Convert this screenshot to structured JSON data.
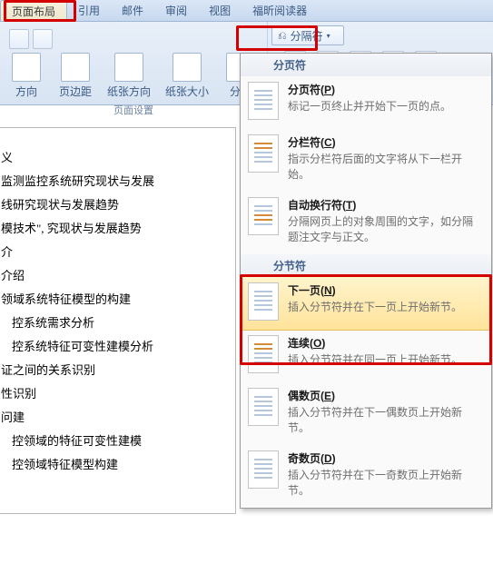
{
  "tabs": {
    "page_layout": "页面布局",
    "references": "引用",
    "mail": "邮件",
    "review": "审阅",
    "view": "视图",
    "foxit": "福昕阅读器"
  },
  "ribbon": {
    "direction": "方向",
    "margins": "页边距",
    "orientation": "纸张方向",
    "size": "纸张大小",
    "columns": "分栏",
    "breaks_label": "分隔符",
    "group_label": "页面设置"
  },
  "doc_lines": [
    "义",
    "监测监控系统研究现状与发展",
    "线研究现状与发展趋势",
    "模技术\", 究现状与发展趋势",
    "",
    "介",
    "介绍",
    "",
    "领域系统特征模型的构建",
    "控系统需求分析",
    "控系统特征可变性建模分析",
    "证之间的关系识别",
    "性识别",
    "问建",
    "控领域的特征可变性建模",
    "控领域特征模型构建"
  ],
  "menu": {
    "page_breaks_header": "分页符",
    "page_break": {
      "title_pre": "分页符(",
      "accel": "P",
      "title_post": ")",
      "desc": "标记一页终止并开始下一页的点。"
    },
    "column_break": {
      "title_pre": "分栏符(",
      "accel": "C",
      "title_post": ")",
      "desc": "指示分栏符后面的文字将从下一栏开始。"
    },
    "text_wrap": {
      "title_pre": "自动换行符(",
      "accel": "T",
      "title_post": ")",
      "desc": "分隔网页上的对象周围的文字，如分隔题注文字与正文。"
    },
    "section_breaks_header": "分节符",
    "next_page": {
      "title_pre": "下一页(",
      "accel": "N",
      "title_post": ")",
      "desc": "插入分节符并在下一页上开始新节。"
    },
    "continuous": {
      "title_pre": "连续(",
      "accel": "O",
      "title_post": ")",
      "desc": "插入分节符并在同一页上开始新节。"
    },
    "even_page": {
      "title_pre": "偶数页(",
      "accel": "E",
      "title_post": ")",
      "desc": "插入分节符并在下一偶数页上开始新节。"
    },
    "odd_page": {
      "title_pre": "奇数页(",
      "accel": "D",
      "title_post": ")",
      "desc": "插入分节符并在下一奇数页上开始新节。"
    }
  }
}
